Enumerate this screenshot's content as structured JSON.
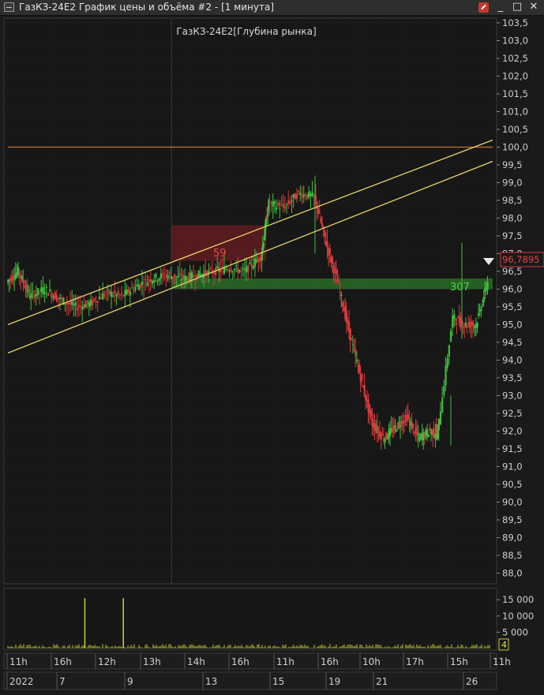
{
  "window": {
    "title": "ГазКЗ-24E2 График цены и объёма #2 - [1 минута]",
    "minimize": "_",
    "maximize": "□",
    "close": "✕"
  },
  "chart": {
    "title": "ГазКЗ-24E2[Глубина рынка]",
    "last_price_label": "96,7895",
    "ask_volume_label": "59",
    "bid_volume_label": "307",
    "volume_last_label": "4"
  },
  "chart_data": [
    {
      "type": "candlestick",
      "title": "ГазКЗ-24E2[Глубина рынка]",
      "y_ticks": [
        "103,5",
        "103,0",
        "102,5",
        "102,0",
        "101,5",
        "101,0",
        "100,5",
        "100,0",
        "99,5",
        "99,0",
        "98,5",
        "98,0",
        "97,5",
        "97,0",
        "96,5",
        "96,0",
        "95,5",
        "95,0",
        "94,5",
        "94,0",
        "93,5",
        "93,0",
        "92,5",
        "92,0",
        "91,5",
        "91,0",
        "90,5",
        "90,0",
        "89,5",
        "89,0",
        "88,5",
        "88,0"
      ],
      "ylim": [
        88.0,
        103.5
      ],
      "x_ticks_time": [
        "11h",
        "16h",
        "12h",
        "13h",
        "14h",
        "16h",
        "11h",
        "16h",
        "10h",
        "17h",
        "15h",
        "11h"
      ],
      "x_ticks_date": [
        "2022",
        "7",
        "9",
        "13",
        "15",
        "19",
        "21",
        "26"
      ],
      "price_path": [
        {
          "x": 0.0,
          "y": 96.2
        },
        {
          "x": 0.3,
          "y": 96.5
        },
        {
          "x": 0.6,
          "y": 95.8
        },
        {
          "x": 1.0,
          "y": 96.0
        },
        {
          "x": 1.4,
          "y": 95.7
        },
        {
          "x": 1.8,
          "y": 95.5
        },
        {
          "x": 2.2,
          "y": 95.6
        },
        {
          "x": 2.6,
          "y": 95.9
        },
        {
          "x": 3.0,
          "y": 95.8
        },
        {
          "x": 3.4,
          "y": 96.1
        },
        {
          "x": 3.8,
          "y": 96.3
        },
        {
          "x": 4.2,
          "y": 96.4
        },
        {
          "x": 4.6,
          "y": 96.3
        },
        {
          "x": 5.0,
          "y": 96.4
        },
        {
          "x": 5.4,
          "y": 96.5
        },
        {
          "x": 5.8,
          "y": 96.6
        },
        {
          "x": 6.2,
          "y": 96.5
        },
        {
          "x": 6.6,
          "y": 96.9
        },
        {
          "x": 6.8,
          "y": 98.4
        },
        {
          "x": 7.2,
          "y": 98.3
        },
        {
          "x": 7.6,
          "y": 98.7
        },
        {
          "x": 8.0,
          "y": 98.6
        },
        {
          "x": 8.3,
          "y": 97.3
        },
        {
          "x": 8.6,
          "y": 96.2
        },
        {
          "x": 8.9,
          "y": 94.8
        },
        {
          "x": 9.2,
          "y": 93.5
        },
        {
          "x": 9.5,
          "y": 92.2
        },
        {
          "x": 9.8,
          "y": 91.8
        },
        {
          "x": 10.1,
          "y": 92.1
        },
        {
          "x": 10.4,
          "y": 92.4
        },
        {
          "x": 10.7,
          "y": 91.8
        },
        {
          "x": 11.0,
          "y": 92.0
        },
        {
          "x": 11.2,
          "y": 91.9
        },
        {
          "x": 11.6,
          "y": 95.2
        },
        {
          "x": 11.9,
          "y": 95.0
        },
        {
          "x": 12.2,
          "y": 95.0
        },
        {
          "x": 12.5,
          "y": 96.2
        }
      ],
      "horizontal_level": 100.0,
      "ask_zone": [
        96.8,
        97.8
      ],
      "bid_zone": [
        96.0,
        96.3
      ],
      "channel_lines": [
        {
          "x1": 0.0,
          "y1": 95.0,
          "x2": 12.6,
          "y2": 100.2
        },
        {
          "x1": 0.0,
          "y1": 94.2,
          "x2": 12.6,
          "y2": 99.6
        }
      ],
      "last_price": 96.7895
    },
    {
      "type": "bar",
      "y_ticks": [
        "15 000",
        "10 000",
        "5 000"
      ],
      "ylim": [
        0,
        17000
      ],
      "spikes": [
        {
          "x": 2.0,
          "value": 15500
        },
        {
          "x": 3.0,
          "value": 15500
        }
      ],
      "baseline_volume": 500
    }
  ]
}
